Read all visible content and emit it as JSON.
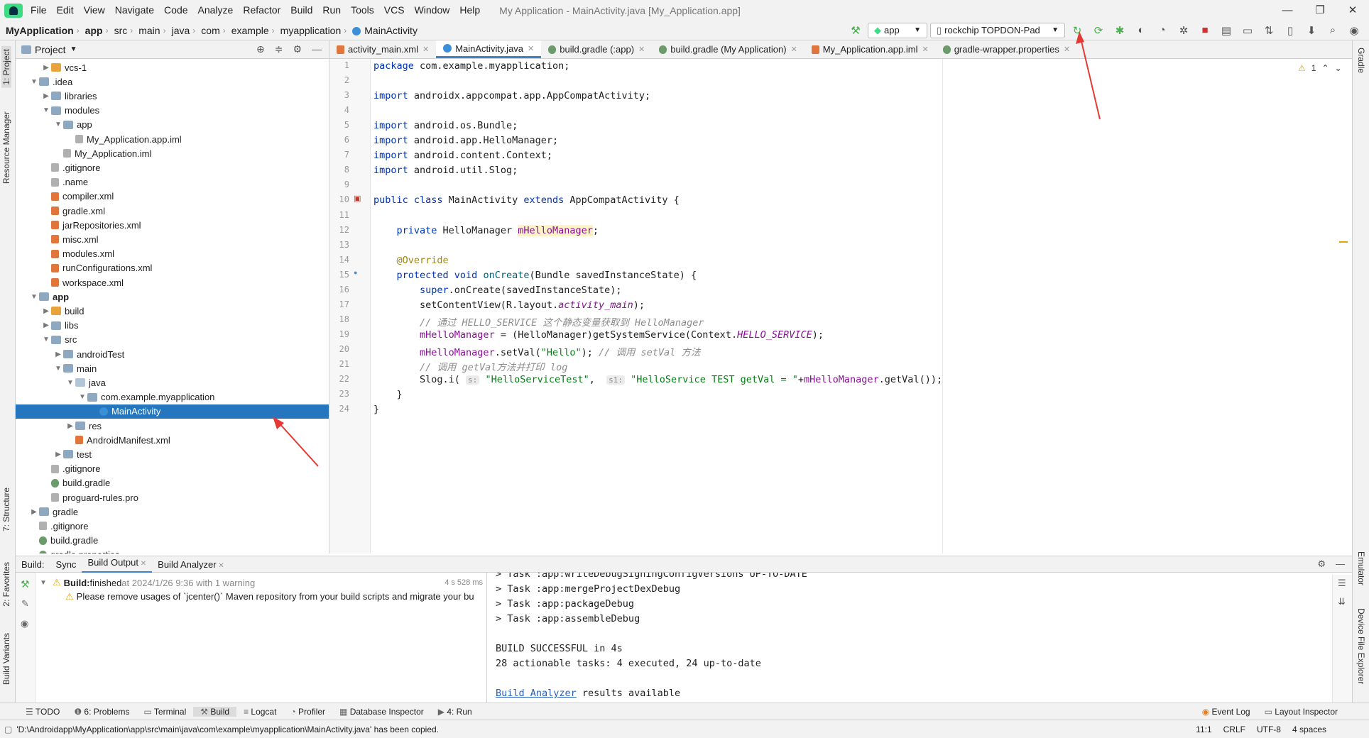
{
  "menu": {
    "items": [
      "File",
      "Edit",
      "View",
      "Navigate",
      "Code",
      "Analyze",
      "Refactor",
      "Build",
      "Run",
      "Tools",
      "VCS",
      "Window",
      "Help"
    ],
    "window_title": "My Application - MainActivity.java [My_Application.app]"
  },
  "breadcrumb": [
    "MyApplication",
    "app",
    "src",
    "main",
    "java",
    "com",
    "example",
    "myapplication",
    "MainActivity"
  ],
  "run_config": {
    "module": "app",
    "device": "rockchip TOPDON-Pad"
  },
  "left_strip": {
    "project": "1: Project",
    "resource_manager": "Resource Manager",
    "structure": "7: Structure",
    "favorites": "2: Favorites",
    "build_variants": "Build Variants"
  },
  "right_strip": {
    "gradle": "Gradle",
    "emulator": "Emulator",
    "device_file_explorer": "Device File Explorer"
  },
  "project_panel": {
    "title": "Project",
    "tree": [
      {
        "label": "vcs-1",
        "depth": 2,
        "icon": "folder-orange",
        "arrow": "right"
      },
      {
        "label": ".idea",
        "depth": 1,
        "icon": "folder",
        "arrow": "down"
      },
      {
        "label": "libraries",
        "depth": 2,
        "icon": "folder",
        "arrow": "right"
      },
      {
        "label": "modules",
        "depth": 2,
        "icon": "folder",
        "arrow": "down"
      },
      {
        "label": "app",
        "depth": 3,
        "icon": "folder",
        "arrow": "down"
      },
      {
        "label": "My_Application.app.iml",
        "depth": 4,
        "icon": "file",
        "arrow": ""
      },
      {
        "label": "My_Application.iml",
        "depth": 3,
        "icon": "file",
        "arrow": ""
      },
      {
        "label": ".gitignore",
        "depth": 2,
        "icon": "file",
        "arrow": ""
      },
      {
        "label": ".name",
        "depth": 2,
        "icon": "file",
        "arrow": ""
      },
      {
        "label": "compiler.xml",
        "depth": 2,
        "icon": "xml",
        "arrow": ""
      },
      {
        "label": "gradle.xml",
        "depth": 2,
        "icon": "xml",
        "arrow": ""
      },
      {
        "label": "jarRepositories.xml",
        "depth": 2,
        "icon": "xml",
        "arrow": ""
      },
      {
        "label": "misc.xml",
        "depth": 2,
        "icon": "xml",
        "arrow": ""
      },
      {
        "label": "modules.xml",
        "depth": 2,
        "icon": "xml",
        "arrow": ""
      },
      {
        "label": "runConfigurations.xml",
        "depth": 2,
        "icon": "xml",
        "arrow": ""
      },
      {
        "label": "workspace.xml",
        "depth": 2,
        "icon": "xml",
        "arrow": ""
      },
      {
        "label": "app",
        "depth": 1,
        "icon": "folder",
        "arrow": "down",
        "bold": true
      },
      {
        "label": "build",
        "depth": 2,
        "icon": "folder-orange",
        "arrow": "right"
      },
      {
        "label": "libs",
        "depth": 2,
        "icon": "folder",
        "arrow": "right"
      },
      {
        "label": "src",
        "depth": 2,
        "icon": "folder",
        "arrow": "down"
      },
      {
        "label": "androidTest",
        "depth": 3,
        "icon": "folder",
        "arrow": "right"
      },
      {
        "label": "main",
        "depth": 3,
        "icon": "folder",
        "arrow": "down"
      },
      {
        "label": "java",
        "depth": 4,
        "icon": "folder-src",
        "arrow": "down"
      },
      {
        "label": "com.example.myapplication",
        "depth": 5,
        "icon": "folder",
        "arrow": "down"
      },
      {
        "label": "MainActivity",
        "depth": 6,
        "icon": "class",
        "arrow": "",
        "selected": true
      },
      {
        "label": "res",
        "depth": 4,
        "icon": "folder",
        "arrow": "right"
      },
      {
        "label": "AndroidManifest.xml",
        "depth": 4,
        "icon": "xml",
        "arrow": ""
      },
      {
        "label": "test",
        "depth": 3,
        "icon": "folder",
        "arrow": "right"
      },
      {
        "label": ".gitignore",
        "depth": 2,
        "icon": "file",
        "arrow": ""
      },
      {
        "label": "build.gradle",
        "depth": 2,
        "icon": "gradle",
        "arrow": ""
      },
      {
        "label": "proguard-rules.pro",
        "depth": 2,
        "icon": "file",
        "arrow": ""
      },
      {
        "label": "gradle",
        "depth": 1,
        "icon": "folder",
        "arrow": "right"
      },
      {
        "label": ".gitignore",
        "depth": 1,
        "icon": "file",
        "arrow": ""
      },
      {
        "label": "build.gradle",
        "depth": 1,
        "icon": "gradle",
        "arrow": ""
      },
      {
        "label": "gradle.properties",
        "depth": 1,
        "icon": "gradle",
        "arrow": ""
      }
    ]
  },
  "editor": {
    "tabs": [
      {
        "label": "activity_main.xml",
        "active": false
      },
      {
        "label": "MainActivity.java",
        "active": true
      },
      {
        "label": "build.gradle (:app)",
        "active": false
      },
      {
        "label": "build.gradle (My Application)",
        "active": false
      },
      {
        "label": "My_Application.app.iml",
        "active": false
      },
      {
        "label": "gradle-wrapper.properties",
        "active": false
      }
    ],
    "warning_count": "1",
    "lines": [
      [
        {
          "t": "package ",
          "c": "kw"
        },
        {
          "t": "com.example.myapplication;"
        }
      ],
      [],
      [
        {
          "t": "import ",
          "c": "kw"
        },
        {
          "t": "androidx.appcompat.app.AppCompatActivity;"
        }
      ],
      [],
      [
        {
          "t": "import ",
          "c": "kw"
        },
        {
          "t": "android.os.Bundle;"
        }
      ],
      [
        {
          "t": "import ",
          "c": "kw"
        },
        {
          "t": "android.app.HelloManager;"
        }
      ],
      [
        {
          "t": "import ",
          "c": "kw"
        },
        {
          "t": "android.content.Context;"
        }
      ],
      [
        {
          "t": "import ",
          "c": "kw"
        },
        {
          "t": "android.util.Slog;"
        }
      ],
      [],
      [
        {
          "t": "public class ",
          "c": "kw"
        },
        {
          "t": "MainActivity "
        },
        {
          "t": "extends ",
          "c": "kw"
        },
        {
          "t": "AppCompatActivity {"
        }
      ],
      [],
      [
        {
          "t": "    "
        },
        {
          "t": "private ",
          "c": "kw"
        },
        {
          "t": "HelloManager "
        },
        {
          "t": "mHelloManager",
          "c": "fld hl"
        },
        {
          "t": ";"
        }
      ],
      [],
      [
        {
          "t": "    "
        },
        {
          "t": "@Override",
          "c": "ann"
        }
      ],
      [
        {
          "t": "    "
        },
        {
          "t": "protected void ",
          "c": "kw"
        },
        {
          "t": "onCreate",
          "c": "fn"
        },
        {
          "t": "(Bundle savedInstanceState) {"
        }
      ],
      [
        {
          "t": "        "
        },
        {
          "t": "super",
          "c": "kw"
        },
        {
          "t": ".onCreate(savedInstanceState);"
        }
      ],
      [
        {
          "t": "        setContentView(R.layout."
        },
        {
          "t": "activity_main",
          "c": "fld it"
        },
        {
          "t": ");"
        }
      ],
      [
        {
          "t": "        "
        },
        {
          "t": "// 通过 HELLO_SERVICE 这个静态变量获取到 HelloManager",
          "c": "cmt"
        }
      ],
      [
        {
          "t": "        "
        },
        {
          "t": "mHelloManager",
          "c": "fld"
        },
        {
          "t": " = (HelloManager)getSystemService(Context."
        },
        {
          "t": "HELLO_SERVICE",
          "c": "fld it"
        },
        {
          "t": ");"
        }
      ],
      [
        {
          "t": "        "
        },
        {
          "t": "mHelloManager",
          "c": "fld"
        },
        {
          "t": ".setVal("
        },
        {
          "t": "\"Hello\"",
          "c": "str"
        },
        {
          "t": "); "
        },
        {
          "t": "// 调用 setVal 方法",
          "c": "cmt"
        }
      ],
      [
        {
          "t": "        "
        },
        {
          "t": "// 调用 getVal方法并打印 log",
          "c": "cmt"
        }
      ],
      [
        {
          "t": "        Slog.i( "
        },
        {
          "t": "s:",
          "c": "hint"
        },
        {
          "t": " "
        },
        {
          "t": "\"HelloServiceTest\"",
          "c": "str"
        },
        {
          "t": ",  "
        },
        {
          "t": "s1:",
          "c": "hint"
        },
        {
          "t": " "
        },
        {
          "t": "\"HelloService TEST getVal = \"",
          "c": "str"
        },
        {
          "t": "+"
        },
        {
          "t": "mHelloManager",
          "c": "fld"
        },
        {
          "t": ".getVal());"
        }
      ],
      [
        {
          "t": "    }"
        }
      ],
      [
        {
          "t": "}"
        }
      ]
    ]
  },
  "build": {
    "label": "Build:",
    "tabs": [
      "Sync",
      "Build Output",
      "Build Analyzer"
    ],
    "active_tab": "Build Output",
    "status_bold": "Build:",
    "status_text": " finished",
    "status_time": " at 2024/1/26 9:36 with 1 warning",
    "duration": "4 s 528 ms",
    "warning": "Please remove usages of `jcenter()` Maven repository from your build scripts and migrate your bu",
    "output_lines": [
      "> Task :app:writeDebugSigningConfigVersions UP-TO-DATE",
      "> Task :app:mergeProjectDexDebug",
      "> Task :app:packageDebug",
      "> Task :app:assembleDebug",
      "",
      "BUILD SUCCESSFUL in 4s",
      "28 actionable tasks: 4 executed, 24 up-to-date",
      ""
    ],
    "analyzer_link": "Build Analyzer",
    "analyzer_suffix": " results available"
  },
  "tool_windows": [
    "TODO",
    "6: Problems",
    "Terminal",
    "Build",
    "Logcat",
    "Profiler",
    "Database Inspector",
    "4: Run"
  ],
  "tool_windows_active": "Build",
  "tool_windows_right": [
    "Event Log",
    "Layout Inspector"
  ],
  "status": {
    "message": "'D:\\Androidapp\\MyApplication\\app\\src\\main\\java\\com\\example\\myapplication\\MainActivity.java' has been copied.",
    "position": "11:1",
    "line_sep": "CRLF",
    "encoding": "UTF-8",
    "indent": "4 spaces"
  },
  "colors": {
    "accent": "#2675bf",
    "annotation_arrow": "#e53935",
    "run_green": "#4caf50",
    "stop_red": "#d32f2f"
  }
}
